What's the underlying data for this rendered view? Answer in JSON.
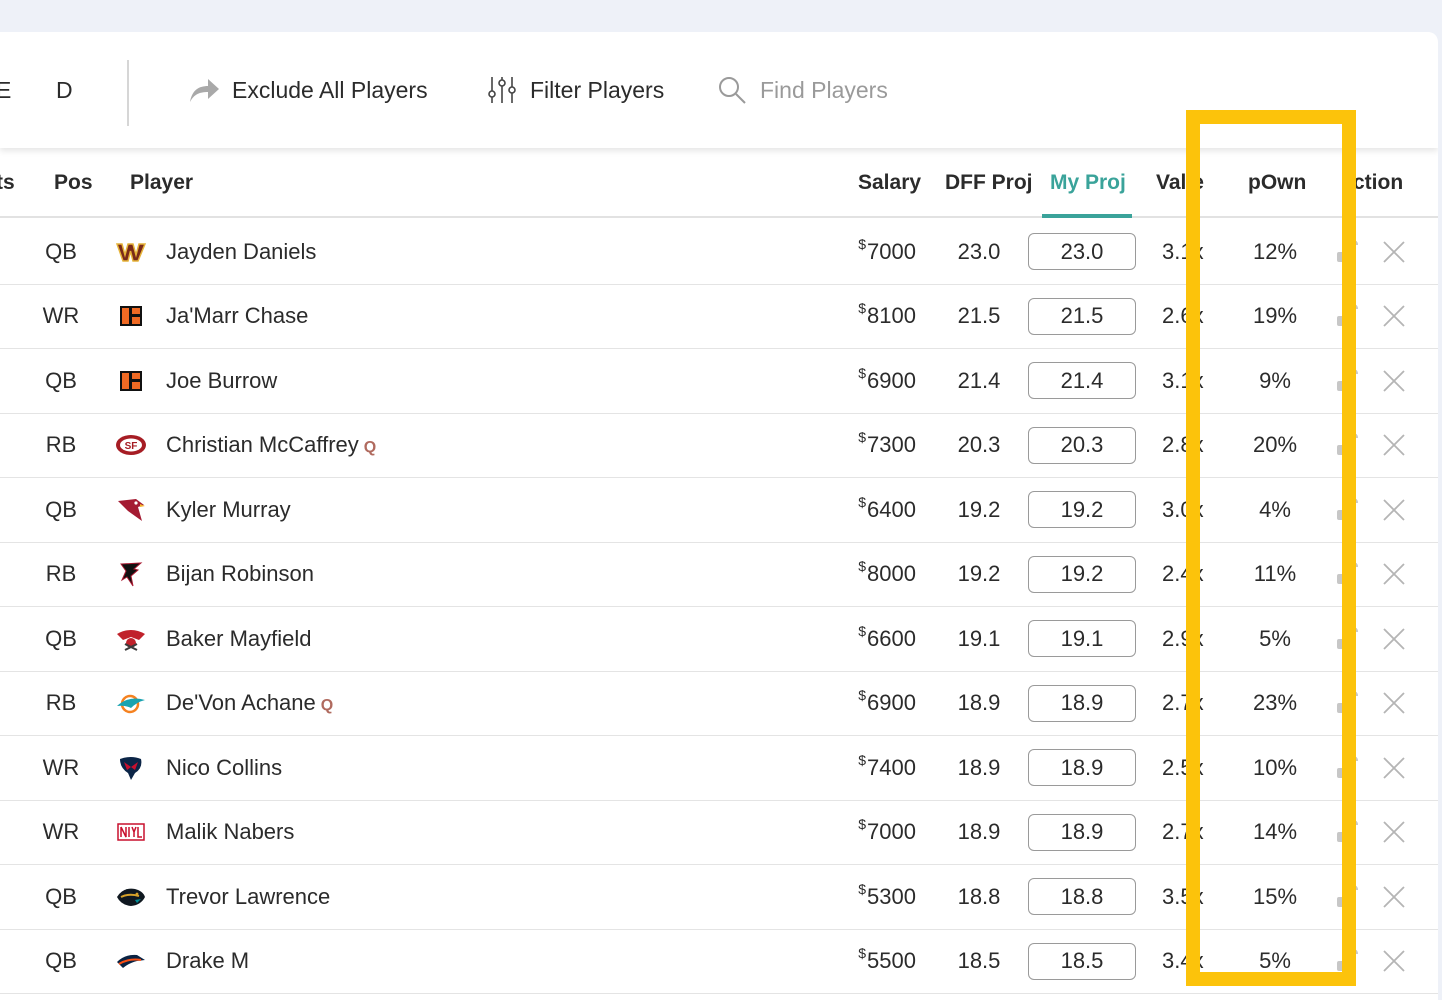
{
  "toolbar": {
    "tab_e": "E",
    "tab_d": "D",
    "exclude_label": "Exclude All Players",
    "filter_label": "Filter Players",
    "find_label": "Find Players"
  },
  "columns": {
    "pts": "ts",
    "pos": "Pos",
    "player": "Player",
    "salary": "Salary",
    "dff_proj": "DFF Proj",
    "my_proj": "My Proj",
    "value": "Val  e",
    "pown": "pOwn",
    "action": "ction"
  },
  "colors": {
    "accent": "#3aa39a",
    "highlight": "#fcc30b",
    "injury_tag": "#b06a5e"
  },
  "rows": [
    {
      "pos": "QB",
      "team_icon": "commanders-logo-icon",
      "name": "Jayden Daniels",
      "tag": "",
      "salary_symbol": "$",
      "salary": "7000",
      "dff": "23.0",
      "my": "23.0",
      "value": "3.1x",
      "pown": "12%"
    },
    {
      "pos": "WR",
      "team_icon": "bengals-logo-icon",
      "name": "Ja'Marr Chase",
      "tag": "",
      "salary_symbol": "$",
      "salary": "8100",
      "dff": "21.5",
      "my": "21.5",
      "value": "2.6x",
      "pown": "19%"
    },
    {
      "pos": "QB",
      "team_icon": "bengals-logo-icon",
      "name": "Joe Burrow",
      "tag": "",
      "salary_symbol": "$",
      "salary": "6900",
      "dff": "21.4",
      "my": "21.4",
      "value": "3.1x",
      "pown": "9%"
    },
    {
      "pos": "RB",
      "team_icon": "49ers-logo-icon",
      "name": "Christian McCaffrey",
      "tag": "Q",
      "salary_symbol": "$",
      "salary": "7300",
      "dff": "20.3",
      "my": "20.3",
      "value": "2.8x",
      "pown": "20%"
    },
    {
      "pos": "QB",
      "team_icon": "cardinals-logo-icon",
      "name": "Kyler Murray",
      "tag": "",
      "salary_symbol": "$",
      "salary": "6400",
      "dff": "19.2",
      "my": "19.2",
      "value": "3.0x",
      "pown": "4%"
    },
    {
      "pos": "RB",
      "team_icon": "falcons-logo-icon",
      "name": "Bijan Robinson",
      "tag": "",
      "salary_symbol": "$",
      "salary": "8000",
      "dff": "19.2",
      "my": "19.2",
      "value": "2.4x",
      "pown": "11%"
    },
    {
      "pos": "QB",
      "team_icon": "buccaneers-logo-icon",
      "name": "Baker Mayfield",
      "tag": "",
      "salary_symbol": "$",
      "salary": "6600",
      "dff": "19.1",
      "my": "19.1",
      "value": "2.9x",
      "pown": "5%"
    },
    {
      "pos": "RB",
      "team_icon": "dolphins-logo-icon",
      "name": "De'Von Achane",
      "tag": "Q",
      "salary_symbol": "$",
      "salary": "6900",
      "dff": "18.9",
      "my": "18.9",
      "value": "2.7x",
      "pown": "23%"
    },
    {
      "pos": "WR",
      "team_icon": "texans-logo-icon",
      "name": "Nico Collins",
      "tag": "",
      "salary_symbol": "$",
      "salary": "7400",
      "dff": "18.9",
      "my": "18.9",
      "value": "2.5x",
      "pown": "10%"
    },
    {
      "pos": "WR",
      "team_icon": "giants-logo-icon",
      "name": "Malik Nabers",
      "tag": "",
      "salary_symbol": "$",
      "salary": "7000",
      "dff": "18.9",
      "my": "18.9",
      "value": "2.7x",
      "pown": "14%"
    },
    {
      "pos": "QB",
      "team_icon": "jaguars-logo-icon",
      "name": "Trevor Lawrence",
      "tag": "",
      "salary_symbol": "$",
      "salary": "5300",
      "dff": "18.8",
      "my": "18.8",
      "value": "3.5x",
      "pown": "15%"
    },
    {
      "pos": "QB",
      "team_icon": "broncos-logo-icon",
      "name": "Drake M",
      "tag": "",
      "salary_symbol": "$",
      "salary": "5500",
      "dff": "18.5",
      "my": "18.5",
      "value": "3.4x",
      "pown": "5%"
    }
  ]
}
